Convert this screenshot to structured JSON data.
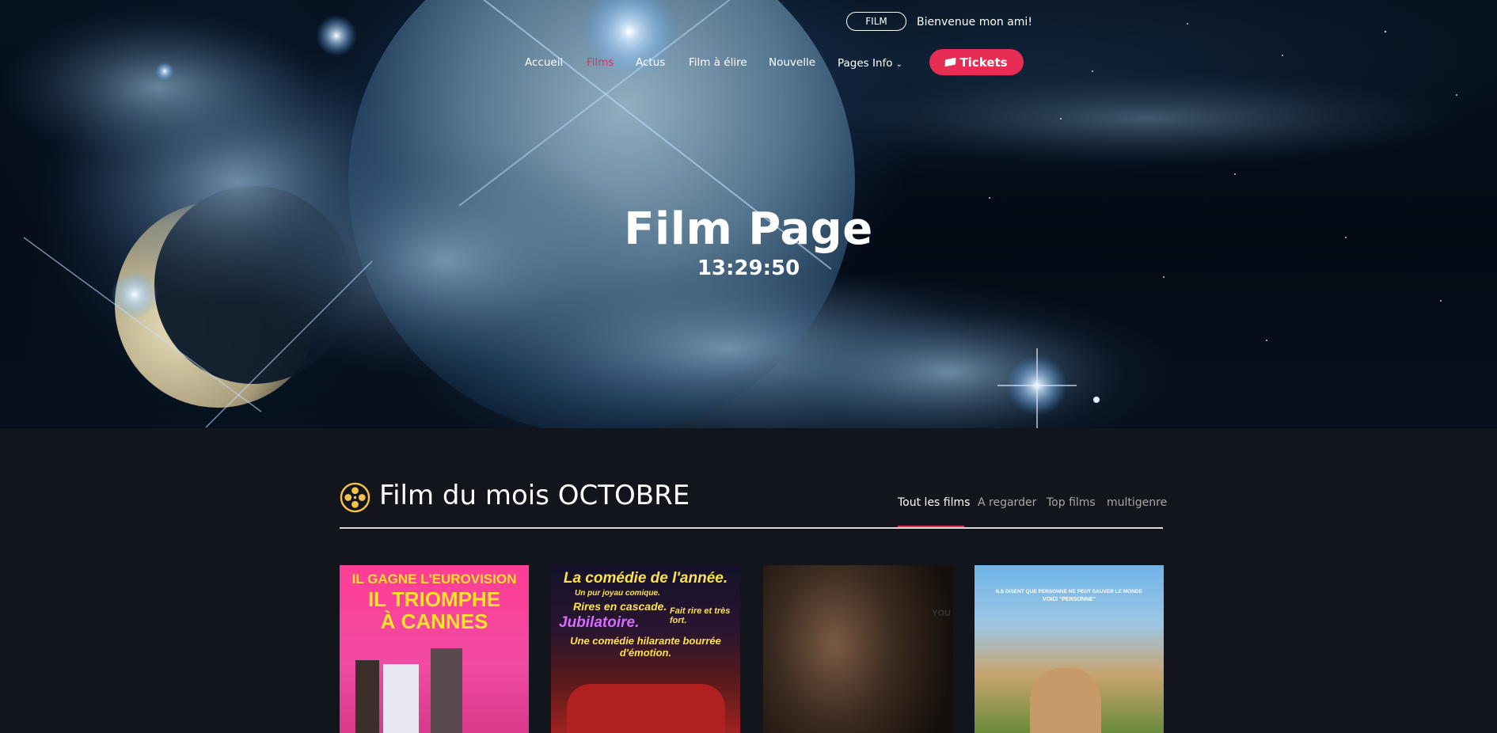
{
  "header": {
    "pill_label": "FILM",
    "welcome": "Bienvenue mon ami!",
    "nav": [
      {
        "label": "Accueil",
        "active": false
      },
      {
        "label": "Films",
        "active": true
      },
      {
        "label": "Actus",
        "active": false
      },
      {
        "label": "Film à élire",
        "active": false
      },
      {
        "label": "Nouvelle",
        "active": false
      },
      {
        "label": "Pages Info",
        "active": false,
        "dropdown": true
      }
    ],
    "tickets_label": "Tickets",
    "accent_color": "#e72d54"
  },
  "hero": {
    "title": "Film Page",
    "clock": "13:29:50"
  },
  "section": {
    "title": "Film du mois OCTOBRE",
    "icon": "film-reel-icon",
    "tabs": [
      {
        "label": "Tout les films",
        "active": true
      },
      {
        "label": "A regarder",
        "active": false
      },
      {
        "label": "Top films",
        "active": false
      },
      {
        "label": "multigenre",
        "active": false
      }
    ]
  },
  "posters": [
    {
      "headline_1": "IL GAGNE L'EUROVISION",
      "headline_2": "IL TRIOMPHE",
      "headline_3": "À CANNES"
    },
    {
      "headline_1": "La comédie de l'année.",
      "line_a": "Un pur joyau comique.",
      "line_b": "Rires en cascade.",
      "line_c": "Jubilatoire.",
      "line_d": "Fait rire et très fort.",
      "line_e": "Une comédie hilarante bourrée d'émotion."
    },
    {
      "side_text": "YOU"
    },
    {
      "headline_1": "ILS DISENT QUE PERSONNE NE PEUT SAUVER LE MONDE",
      "headline_2": "VOICI \"PERSONNE\""
    }
  ]
}
